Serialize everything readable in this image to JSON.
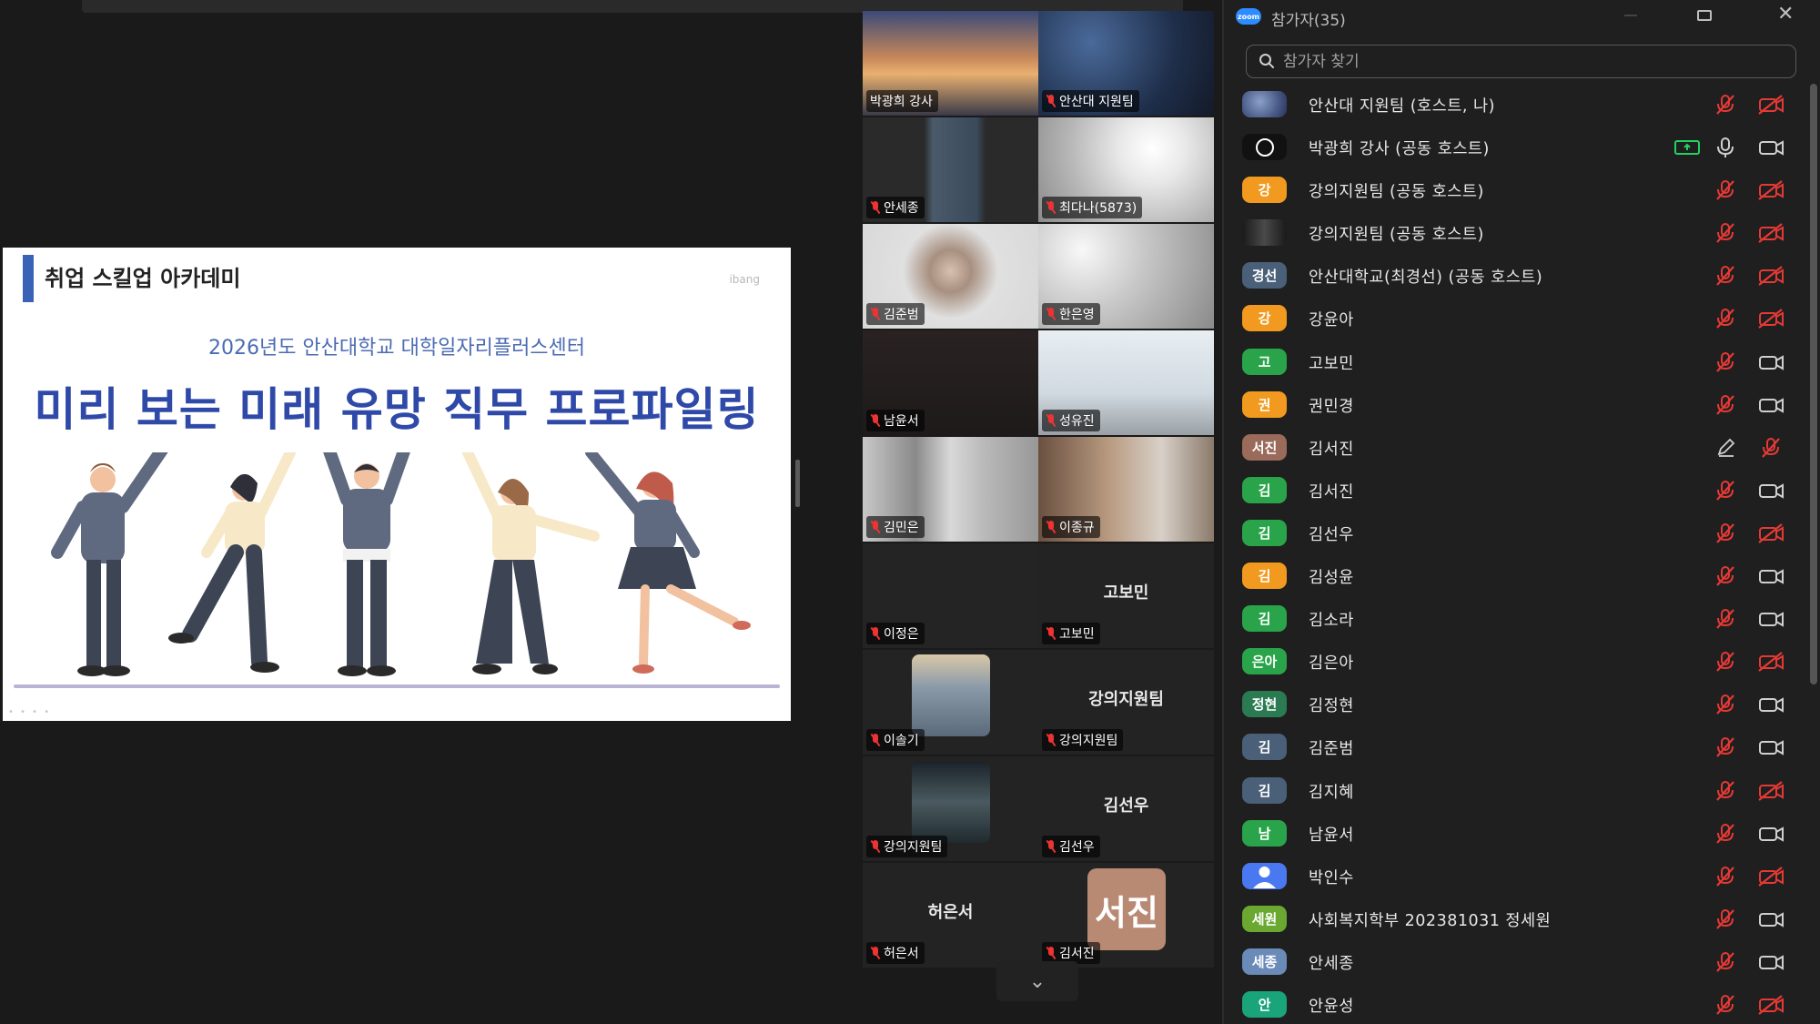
{
  "slide": {
    "academy": "취업 스킬업 아카데미",
    "brand": "ibang",
    "subtitle": "2026년도 안산대학교 대학일자리플러스센터",
    "title": "미리 보는 미래 유망 직무 프로파일링"
  },
  "gallery": [
    {
      "label": "박광희 강사",
      "style": "sunset",
      "active": true,
      "muted": false
    },
    {
      "label": "안산대 지원팀",
      "style": "starry",
      "muted": true
    },
    {
      "label": "안세종",
      "style": "dark-person",
      "muted": true
    },
    {
      "label": "최다나(5873)",
      "style": "bright",
      "muted": true
    },
    {
      "label": "김준범",
      "style": "person",
      "muted": true
    },
    {
      "label": "한은영",
      "style": "light-room",
      "muted": true
    },
    {
      "label": "남윤서",
      "style": "dark",
      "muted": true
    },
    {
      "label": "성유진",
      "style": "light-wall",
      "muted": true
    },
    {
      "label": "김민은",
      "style": "curtain",
      "muted": true
    },
    {
      "label": "이종규",
      "style": "person-face",
      "muted": true
    },
    {
      "label": "이정은",
      "style": "blank",
      "muted": true
    },
    {
      "label": "고보민",
      "big": "고보민",
      "muted": true
    },
    {
      "label": "이솔기",
      "style": "thumb-photo",
      "muted": true
    },
    {
      "label": "강의지원팀",
      "big": "강의지원팀",
      "muted": true
    },
    {
      "label": "강의지원팀",
      "style": "thumb-night",
      "muted": true
    },
    {
      "label": "김선우",
      "big": "김선우",
      "muted": true
    },
    {
      "label": "허은서",
      "big": "허은서",
      "muted": true
    },
    {
      "label": "김서진",
      "avatar": "서진",
      "muted": true
    }
  ],
  "panel": {
    "logo": "zoom",
    "title": "참가자(35)",
    "search_placeholder": "참가자 찾기"
  },
  "participants": [
    {
      "name": "안산대 지원팀 (호스트, 나)",
      "av": "",
      "color": "#4a5a78",
      "mic": "off",
      "cam": "off",
      "photo": "sky"
    },
    {
      "name": "박광희 강사 (공동 호스트)",
      "av": "",
      "color": "#111111",
      "mic": "on",
      "cam": "on",
      "share": true,
      "photo": "logo"
    },
    {
      "name": "강의지원팀 (공동 호스트)",
      "av": "강",
      "color": "#f29a1f",
      "mic": "off",
      "cam": "off"
    },
    {
      "name": "강의지원팀 (공동 호스트)",
      "av": "",
      "color": "#2b2b2b",
      "mic": "off",
      "cam": "off",
      "photo": "dark"
    },
    {
      "name": "안산대학교(최경선) (공동 호스트)",
      "av": "경선",
      "color": "#4a5f78",
      "mic": "off",
      "cam": "off"
    },
    {
      "name": "강윤아",
      "av": "강",
      "color": "#f29a1f",
      "mic": "off",
      "cam": "off"
    },
    {
      "name": "고보민",
      "av": "고",
      "color": "#2aa44a",
      "mic": "off",
      "cam": "on"
    },
    {
      "name": "권민경",
      "av": "권",
      "color": "#f29a1f",
      "mic": "off",
      "cam": "on"
    },
    {
      "name": "김서진",
      "av": "서진",
      "color": "#9a6a5a",
      "mic": "pen",
      "cam": "micoff"
    },
    {
      "name": "김서진",
      "av": "김",
      "color": "#2aa44a",
      "mic": "off",
      "cam": "on"
    },
    {
      "name": "김선우",
      "av": "김",
      "color": "#2aa44a",
      "mic": "off",
      "cam": "off"
    },
    {
      "name": "김성윤",
      "av": "김",
      "color": "#f29a1f",
      "mic": "off",
      "cam": "on"
    },
    {
      "name": "김소라",
      "av": "김",
      "color": "#2aa44a",
      "mic": "off",
      "cam": "on"
    },
    {
      "name": "김은아",
      "av": "은아",
      "color": "#2aa44a",
      "mic": "off",
      "cam": "off"
    },
    {
      "name": "김정현",
      "av": "정현",
      "color": "#2a7a52",
      "mic": "off",
      "cam": "on"
    },
    {
      "name": "김준범",
      "av": "김",
      "color": "#4a5f78",
      "mic": "off",
      "cam": "on"
    },
    {
      "name": "김지혜",
      "av": "김",
      "color": "#4a5f78",
      "mic": "off",
      "cam": "off"
    },
    {
      "name": "남윤서",
      "av": "남",
      "color": "#2aa44a",
      "mic": "off",
      "cam": "on"
    },
    {
      "name": "박인수",
      "av": "",
      "color": "#4a78f0",
      "mic": "off",
      "cam": "off",
      "photo": "person"
    },
    {
      "name": "사회복지학부 202381031 정세원",
      "av": "세원",
      "color": "#6aa832",
      "mic": "off",
      "cam": "on"
    },
    {
      "name": "안세종",
      "av": "세종",
      "color": "#6a8ab8",
      "mic": "off",
      "cam": "on"
    },
    {
      "name": "안윤성",
      "av": "안",
      "color": "#1aa47a",
      "mic": "off",
      "cam": "off"
    }
  ],
  "gallery_more": "⌄",
  "colors": {
    "accent_green": "#23d160",
    "muted_red": "#e53935",
    "slide_title": "#2f49a8",
    "panel_bg": "#1f1f1f"
  }
}
